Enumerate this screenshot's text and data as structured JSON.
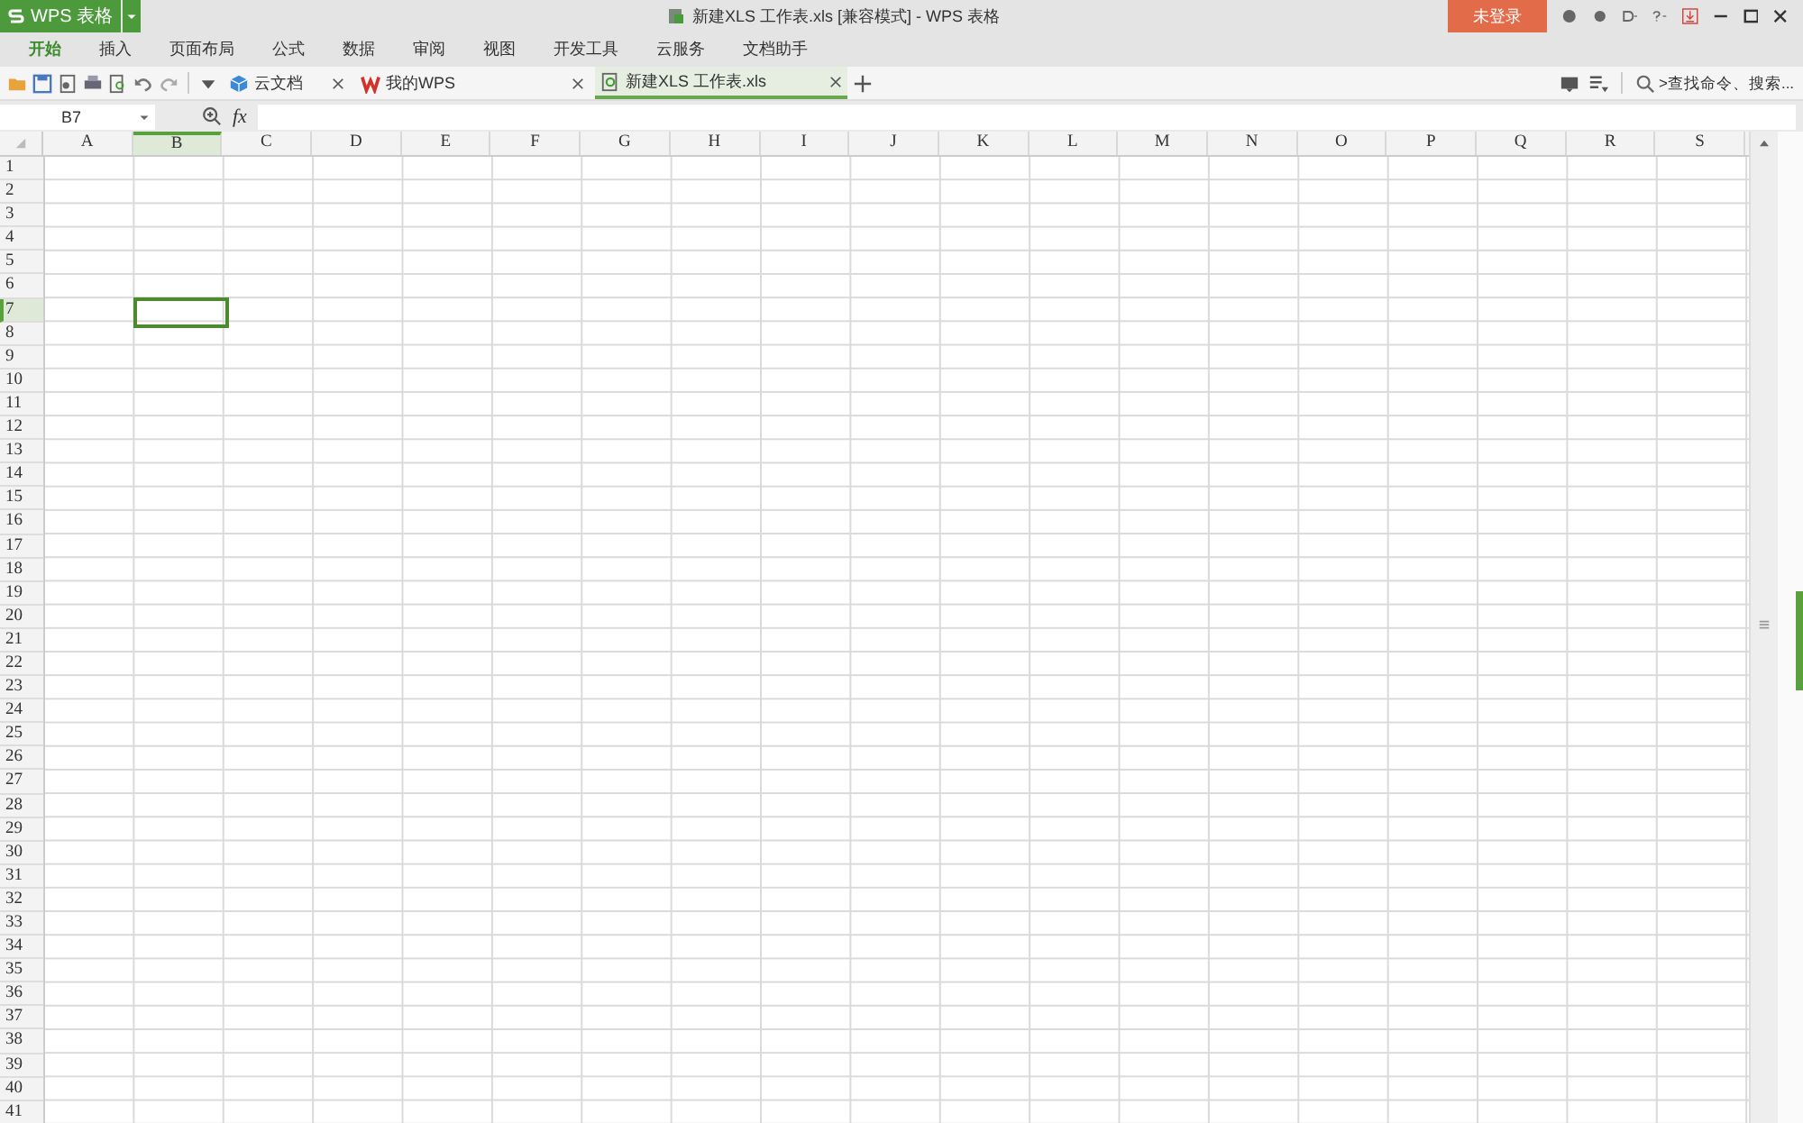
{
  "app_button": {
    "label": "WPS 表格"
  },
  "window": {
    "title": "新建XLS 工作表.xls [兼容模式] - WPS 表格"
  },
  "login_button": {
    "label": "未登录"
  },
  "menu_tabs": [
    {
      "label": "开始",
      "selected": true
    },
    {
      "label": "插入",
      "selected": false
    },
    {
      "label": "页面布局",
      "selected": false
    },
    {
      "label": "公式",
      "selected": false
    },
    {
      "label": "数据",
      "selected": false
    },
    {
      "label": "审阅",
      "selected": false
    },
    {
      "label": "视图",
      "selected": false
    },
    {
      "label": "开发工具",
      "selected": false
    },
    {
      "label": "云服务",
      "selected": false
    },
    {
      "label": "文档助手",
      "selected": false
    }
  ],
  "doc_tabs": [
    {
      "label": "云文档",
      "kind": "cloud",
      "selected": false
    },
    {
      "label": "我的WPS",
      "kind": "wps",
      "selected": false
    },
    {
      "label": "新建XLS 工作表.xls",
      "kind": "sheet",
      "selected": true
    }
  ],
  "command_search": {
    "placeholder": ">查找命令、搜索..."
  },
  "formula_bar": {
    "name_box": "B7",
    "fx": "fx"
  },
  "columns": [
    {
      "label": "A",
      "selected": false
    },
    {
      "label": "B",
      "selected": true
    },
    {
      "label": "C",
      "selected": false
    },
    {
      "label": "D",
      "selected": false
    },
    {
      "label": "E",
      "selected": false
    },
    {
      "label": "F",
      "selected": false
    },
    {
      "label": "G",
      "selected": false
    },
    {
      "label": "H",
      "selected": false
    },
    {
      "label": "I",
      "selected": false
    },
    {
      "label": "J",
      "selected": false
    },
    {
      "label": "K",
      "selected": false
    },
    {
      "label": "L",
      "selected": false
    },
    {
      "label": "M",
      "selected": false
    },
    {
      "label": "N",
      "selected": false
    },
    {
      "label": "O",
      "selected": false
    },
    {
      "label": "P",
      "selected": false
    },
    {
      "label": "Q",
      "selected": false
    },
    {
      "label": "R",
      "selected": false
    },
    {
      "label": "S",
      "selected": false
    }
  ],
  "rows": [
    {
      "label": "1",
      "selected": false
    },
    {
      "label": "2",
      "selected": false
    },
    {
      "label": "3",
      "selected": false
    },
    {
      "label": "4",
      "selected": false
    },
    {
      "label": "5",
      "selected": false
    },
    {
      "label": "6",
      "selected": false
    },
    {
      "label": "7",
      "selected": true
    },
    {
      "label": "8",
      "selected": false
    },
    {
      "label": "9",
      "selected": false
    },
    {
      "label": "10",
      "selected": false
    },
    {
      "label": "11",
      "selected": false
    },
    {
      "label": "12",
      "selected": false
    },
    {
      "label": "13",
      "selected": false
    },
    {
      "label": "14",
      "selected": false
    },
    {
      "label": "15",
      "selected": false
    },
    {
      "label": "16",
      "selected": false
    },
    {
      "label": "17",
      "selected": false
    },
    {
      "label": "18",
      "selected": false
    },
    {
      "label": "19",
      "selected": false
    },
    {
      "label": "20",
      "selected": false
    },
    {
      "label": "21",
      "selected": false
    },
    {
      "label": "22",
      "selected": false
    },
    {
      "label": "23",
      "selected": false
    },
    {
      "label": "24",
      "selected": false
    },
    {
      "label": "25",
      "selected": false
    },
    {
      "label": "26",
      "selected": false
    },
    {
      "label": "27",
      "selected": false
    },
    {
      "label": "28",
      "selected": false
    },
    {
      "label": "29",
      "selected": false
    },
    {
      "label": "30",
      "selected": false
    },
    {
      "label": "31",
      "selected": false
    },
    {
      "label": "32",
      "selected": false
    },
    {
      "label": "33",
      "selected": false
    },
    {
      "label": "34",
      "selected": false
    },
    {
      "label": "35",
      "selected": false
    },
    {
      "label": "36",
      "selected": false
    },
    {
      "label": "37",
      "selected": false
    },
    {
      "label": "38",
      "selected": false
    },
    {
      "label": "39",
      "selected": false
    },
    {
      "label": "40",
      "selected": false
    },
    {
      "label": "41",
      "selected": false
    }
  ]
}
